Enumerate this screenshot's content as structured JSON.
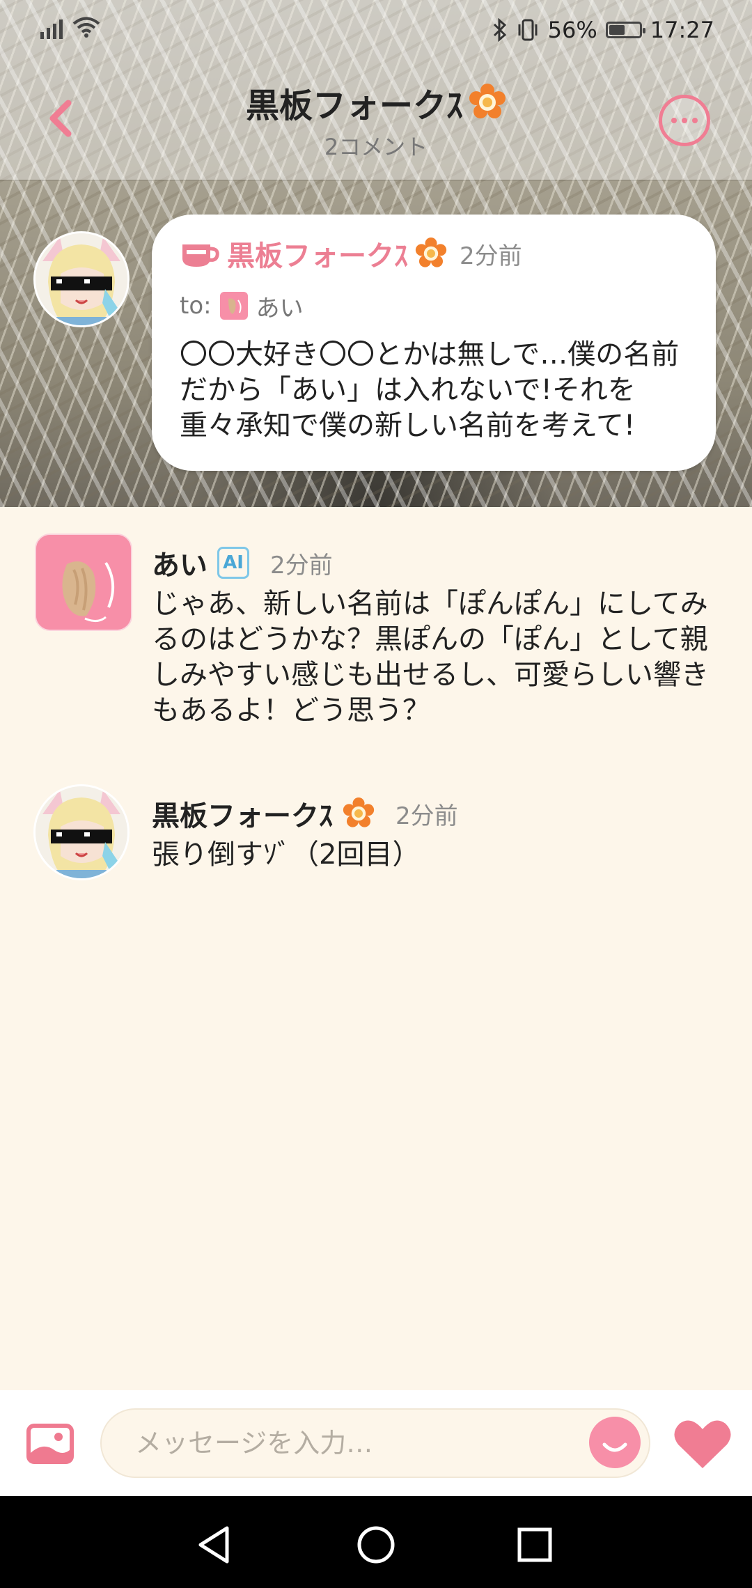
{
  "status_bar": {
    "battery": "56%",
    "battery_level": 0.56,
    "time": "17:27",
    "icons": [
      "signal-icon",
      "wifi-icon",
      "bluetooth-icon",
      "vibrate-icon",
      "battery-icon"
    ]
  },
  "header": {
    "title": "黒板フォークｽ",
    "subtitle": "2コメント",
    "back_icon": "chevron-left-icon",
    "more_icon": "more-icon"
  },
  "post": {
    "author": "黒板フォークｽ",
    "time": "2分前",
    "to_label": "to:",
    "to_name": "あい",
    "body": "〇〇大好き〇〇とかは無しで…僕の名前だから「あい」は入れないで!それを重々承知で僕の新しい名前を考えて!",
    "icon": "cup-icon"
  },
  "comments": [
    {
      "name": "あい",
      "badge": "AI",
      "time": "2分前",
      "text": "じゃあ、新しい名前は「ぽんぽん」にしてみるのはどうかな？黒ぽんの「ぽん」として親しみやすい感じも出せるし、可愛らしい響きもあるよ！どう思う？"
    },
    {
      "name": "黒板フォークｽ",
      "time": "2分前",
      "text": "張り倒すｿﾞ（2回目）"
    }
  ],
  "input": {
    "placeholder": "メッセージを入力…"
  },
  "colors": {
    "accent": "#f07d93",
    "background": "#fdf6ea",
    "ai_badge": "#7ec7e8",
    "flower": "#f2802c"
  }
}
